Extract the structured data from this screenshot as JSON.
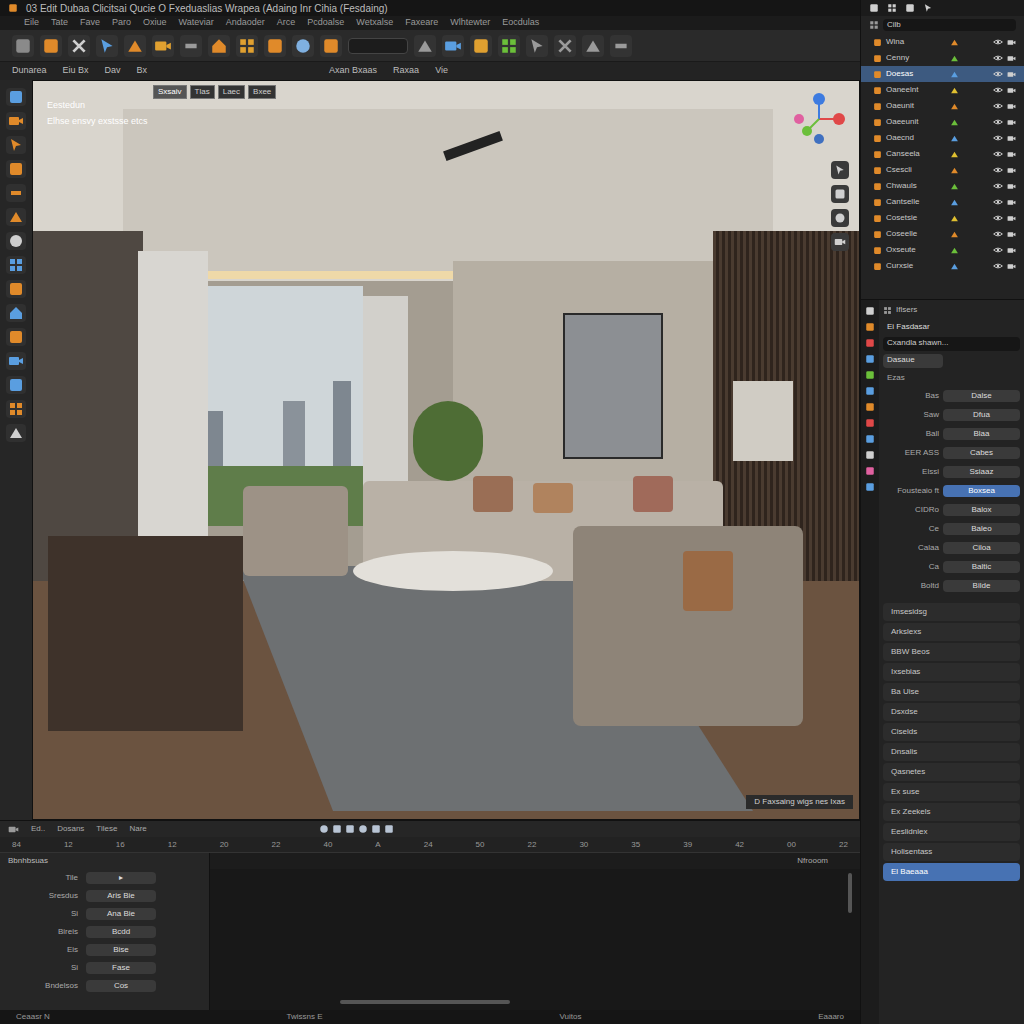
{
  "window": {
    "title": "03 Edit Dubaa  Clicitsai  Qucie  O Fxeduaslias  Wrapea  (Adaing Inr Cihia  (Fesdaing)"
  },
  "menu": [
    "Eile",
    "Tate",
    "Fave",
    "Paro",
    "Oxiue",
    "Wateviar",
    "Andaoder",
    "Arce",
    "Pcdoalse",
    "Wetxalse",
    "Faxeare",
    "Wlhtewter",
    "Eocdulas"
  ],
  "viewport": {
    "header_left": [
      "Dunarea",
      "Eiu Bx",
      "Dav",
      "Bx"
    ],
    "header_right": [
      "Axan Bxaas",
      "Raxaa",
      "Vie"
    ],
    "tabs": [
      {
        "label": "Sxsaiv",
        "selected": true
      },
      {
        "label": "Tlas",
        "selected": false
      },
      {
        "label": "Laec",
        "selected": false
      },
      {
        "label": "Bxee",
        "selected": false
      }
    ],
    "overlay": [
      "Eestedun",
      "Elhse ensvy exstsse etcs"
    ],
    "footer": "D Faxsaing wigs nes Ixas"
  },
  "outliner": {
    "search": "Cilb",
    "items": [
      {
        "label": "Wina",
        "selected": false
      },
      {
        "label": "Cenny",
        "selected": false
      },
      {
        "label": "Doesas",
        "selected": true
      },
      {
        "label": "Oaneelnt",
        "selected": false
      },
      {
        "label": "Oaeunit",
        "selected": false
      },
      {
        "label": "Oaeeunit",
        "selected": false
      },
      {
        "label": "Oaecnd",
        "selected": false
      },
      {
        "label": "Canseela",
        "selected": false
      },
      {
        "label": "Csescli",
        "selected": false
      },
      {
        "label": "Chwauls",
        "selected": false
      },
      {
        "label": "Cantselle",
        "selected": false
      },
      {
        "label": "Cosetsie",
        "selected": false
      },
      {
        "label": "Coseelle",
        "selected": false
      },
      {
        "label": "Oxseute",
        "selected": false
      },
      {
        "label": "Curxsie",
        "selected": false
      }
    ]
  },
  "properties": {
    "header": "Iflsers",
    "title": "Ei Fasdasar",
    "field": "Cxandla shawn...",
    "button": "Dasaue",
    "section": "Ezas",
    "rows": [
      {
        "label": "Bas",
        "value": "Dalse",
        "selected": false
      },
      {
        "label": "Saw",
        "value": "Dfua",
        "selected": false
      },
      {
        "label": "Ball",
        "value": "Blaa",
        "selected": false
      },
      {
        "label": "EER ASS",
        "value": "Cabes",
        "selected": false
      },
      {
        "label": "Elssi",
        "value": "Ssiaaz",
        "selected": false
      },
      {
        "label": "Fousteaio ft",
        "value": "Boxsea",
        "selected": true
      },
      {
        "label": "CIDRo",
        "value": "Balox",
        "selected": false
      },
      {
        "label": "Ce",
        "value": "Baleo",
        "selected": false
      },
      {
        "label": "Calaa",
        "value": "Ciloa",
        "selected": false
      },
      {
        "label": "Ca",
        "value": "Baltic",
        "selected": false
      },
      {
        "label": "Boltd",
        "value": "Bilde",
        "selected": false
      }
    ],
    "list": [
      {
        "label": "Imsesidsg",
        "selected": false
      },
      {
        "label": "Arkslexs",
        "selected": false
      },
      {
        "label": "BBW Beos",
        "selected": false
      },
      {
        "label": "Ixsebias",
        "selected": false
      },
      {
        "label": "Ba Uise",
        "selected": false
      },
      {
        "label": "Dsxdse",
        "selected": false
      },
      {
        "label": "Ciselds",
        "selected": false
      },
      {
        "label": "Dnsalis",
        "selected": false
      },
      {
        "label": "Qasnetes",
        "selected": false
      },
      {
        "label": "Ex suse",
        "selected": false
      },
      {
        "label": "Ex Zeekels",
        "selected": false
      },
      {
        "label": "Eeslidnlex",
        "selected": false
      },
      {
        "label": "Holisentass",
        "selected": false
      },
      {
        "label": "El Baeaaa",
        "selected": true
      }
    ]
  },
  "timeline": {
    "menu": [
      "Ed..",
      "Dosans",
      "Tilese",
      "Nare"
    ],
    "ruler": [
      "84",
      "12",
      "16",
      "12",
      "20",
      "22",
      "40",
      "A",
      "24",
      "50",
      "22",
      "30",
      "35",
      "39",
      "42",
      "00",
      "22"
    ],
    "frame": "Nfrooom",
    "panel_title": "Bbnhbsuas",
    "rows": [
      {
        "label": "Tile",
        "value": "▸"
      },
      {
        "label": "Sresdus",
        "value": "Aris Bie"
      },
      {
        "label": "Si",
        "value": "Ana Bie"
      },
      {
        "label": "Bireis",
        "value": "Bcdd"
      },
      {
        "label": "Eis",
        "value": "Bise"
      },
      {
        "label": "Si",
        "value": "Fase"
      },
      {
        "label": "Bndelsos",
        "value": "Cos"
      }
    ]
  },
  "status_bar": [
    "Ceaasr N",
    "Twissns E",
    "Vuitos",
    "Eaaaro"
  ]
}
